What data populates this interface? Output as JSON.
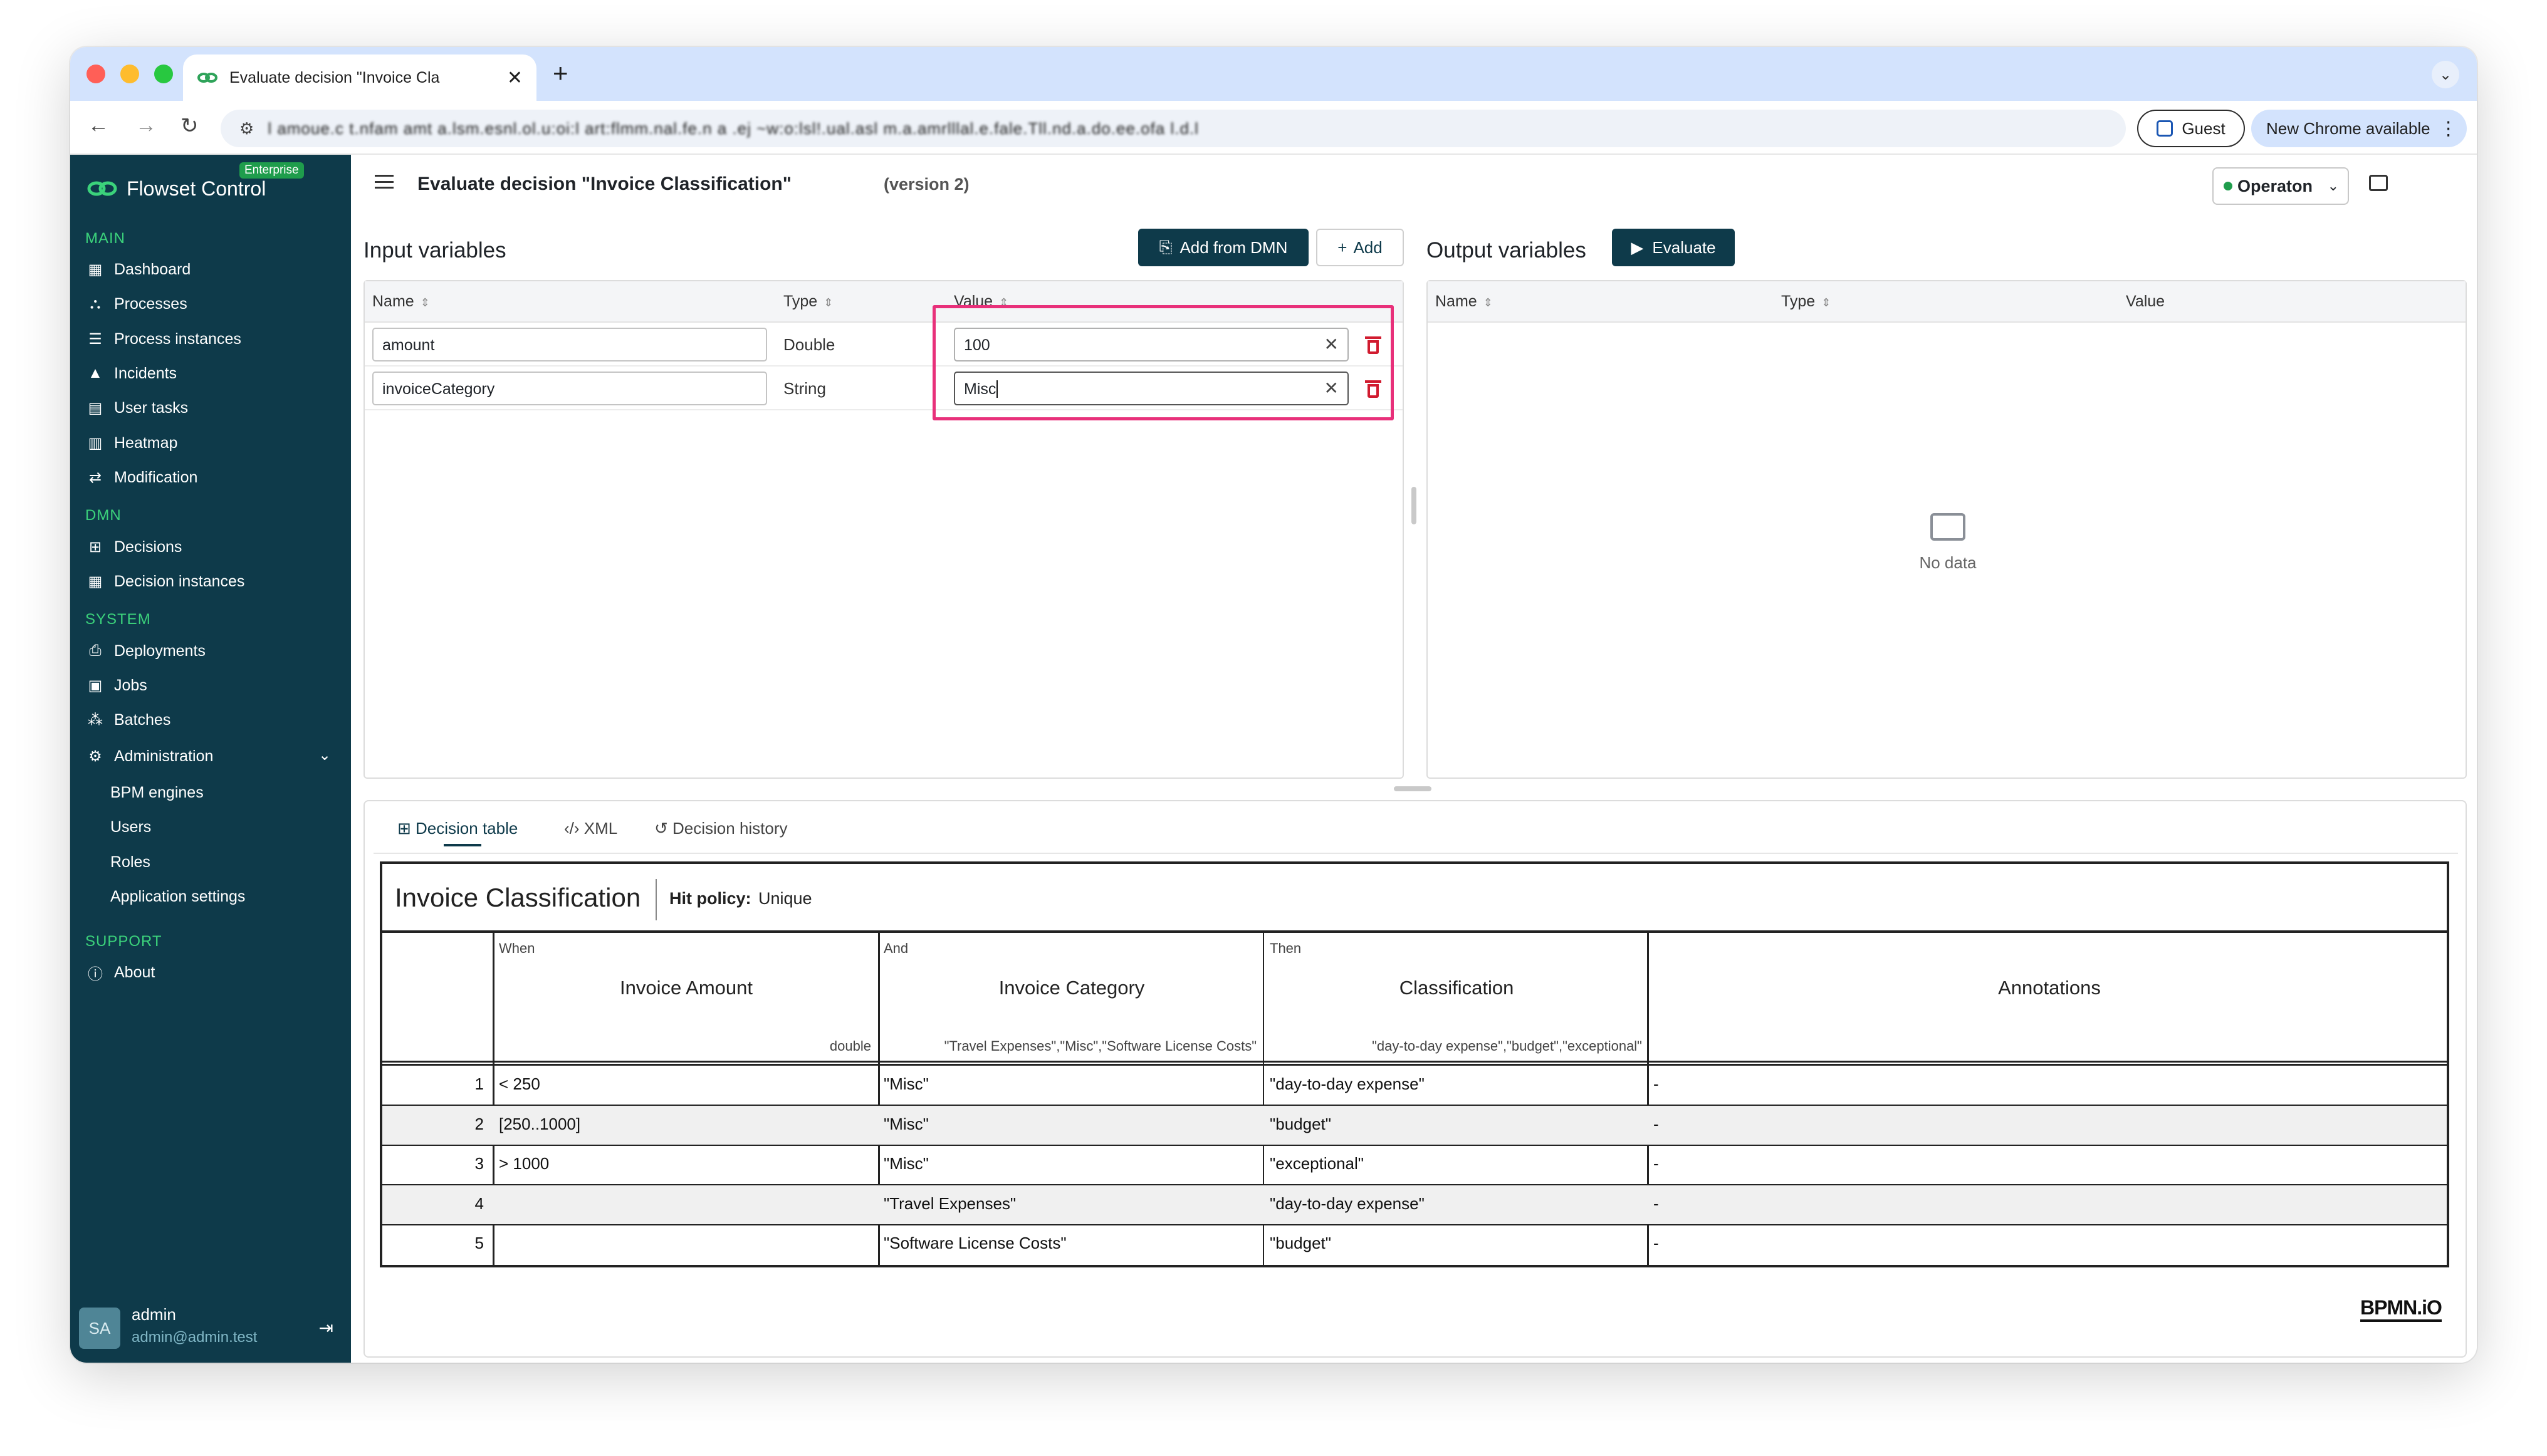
{
  "browser": {
    "tab_title": "Evaluate decision \"Invoice Cla",
    "address": "l amoue.c t.nfam amt a.lsm.esnl.ol.u:oi:l art:flmm.nal.fe.n a .ej ~w:o:lsl!.ual.asl m.a.amrlllal.e.fale.Tll.nd.a.do.ee.ofa l.d.l",
    "guest_label": "Guest",
    "update_label": "New Chrome available"
  },
  "sidebar": {
    "brand": "Flowset Control",
    "badge": "Enterprise",
    "sections": {
      "main": "MAIN",
      "dmn": "DMN",
      "system": "SYSTEM",
      "support": "SUPPORT"
    },
    "main_items": [
      "Dashboard",
      "Processes",
      "Process instances",
      "Incidents",
      "User tasks",
      "Heatmap",
      "Modification"
    ],
    "dmn_items": [
      "Decisions",
      "Decision instances"
    ],
    "system_items": [
      "Deployments",
      "Jobs",
      "Batches"
    ],
    "admin_label": "Administration",
    "admin_items": [
      "BPM engines",
      "Users",
      "Roles",
      "Application settings"
    ],
    "support_items": [
      "About"
    ],
    "user": {
      "initials": "SA",
      "name": "admin",
      "email": "admin@admin.test"
    }
  },
  "header": {
    "title": "Evaluate decision \"Invoice Classification\"",
    "version": "(version 2)",
    "engine": "Operaton"
  },
  "input_panel": {
    "title": "Input variables",
    "add_from_dmn": "Add from DMN",
    "add": "Add",
    "columns": [
      "Name",
      "Type",
      "Value"
    ],
    "rows": [
      {
        "name": "amount",
        "type": "Double",
        "value": "100"
      },
      {
        "name": "invoiceCategory",
        "type": "String",
        "value": "Misc"
      }
    ]
  },
  "output_panel": {
    "title": "Output variables",
    "evaluate": "Evaluate",
    "columns": [
      "Name",
      "Type",
      "Value"
    ],
    "empty": "No data"
  },
  "tabs": [
    "Decision table",
    "XML",
    "Decision history"
  ],
  "decision_table": {
    "title": "Invoice Classification",
    "hit_policy_label": "Hit policy:",
    "hit_policy": "Unique",
    "inputs": [
      {
        "clause": "When",
        "label": "Invoice Amount",
        "type": "double"
      },
      {
        "clause": "And",
        "label": "Invoice Category",
        "type": "\"Travel Expenses\",\"Misc\",\"Software License Costs\""
      }
    ],
    "output": {
      "clause": "Then",
      "label": "Classification",
      "type": "\"day-to-day expense\",\"budget\",\"exceptional\""
    },
    "annotations_label": "Annotations",
    "rows": [
      {
        "num": "1",
        "amount": "< 250",
        "category": "\"Misc\"",
        "classification": "\"day-to-day expense\"",
        "annotation": "-"
      },
      {
        "num": "2",
        "amount": "[250..1000]",
        "category": "\"Misc\"",
        "classification": "\"budget\"",
        "annotation": "-"
      },
      {
        "num": "3",
        "amount": "> 1000",
        "category": "\"Misc\"",
        "classification": "\"exceptional\"",
        "annotation": "-"
      },
      {
        "num": "4",
        "amount": "",
        "category": "\"Travel Expenses\"",
        "classification": "\"day-to-day expense\"",
        "annotation": "-"
      },
      {
        "num": "5",
        "amount": "",
        "category": "\"Software License Costs\"",
        "classification": "\"budget\"",
        "annotation": "-"
      }
    ],
    "watermark": "BPMN.iO"
  },
  "colors": {
    "sidebar": "#0e3a4a",
    "accent": "#3bd27b",
    "highlight": "#e8307a",
    "danger": "#d11b2f"
  }
}
